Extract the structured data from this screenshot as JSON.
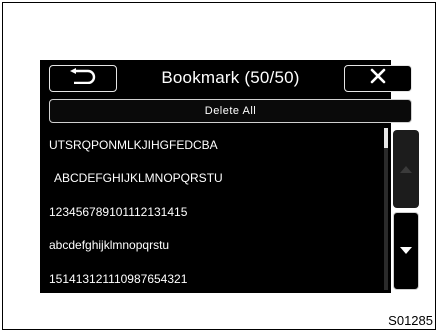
{
  "header": {
    "title": "Bookmark (50/50)",
    "back_icon": "return-arrow-icon",
    "close_icon": "close-x-icon"
  },
  "toolbar": {
    "delete_all_label": "Delete All"
  },
  "bookmarks": [
    "UTSRQPONMLKJIHGFEDCBA",
    "ABCDEFGHIJKLMNOPQRSTU",
    "123456789101112131415",
    "abcdefghijklmnopqrstu",
    "151413121110987654321"
  ],
  "scroll": {
    "up_icon": "triangle-up-icon",
    "down_icon": "triangle-down-icon",
    "up_enabled": false,
    "position_fraction": 0.0
  },
  "figure_code": "S01285",
  "colors": {
    "screen_bg": "#000000",
    "text": "#ffffff",
    "disabled_button": "#1c1c1c"
  }
}
